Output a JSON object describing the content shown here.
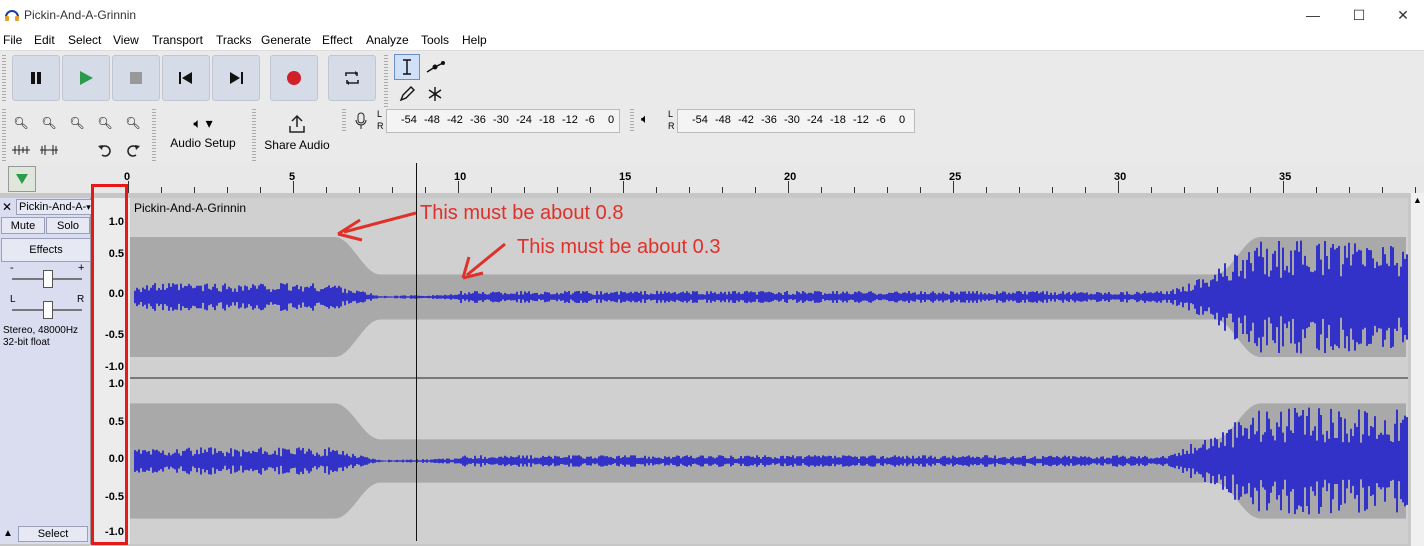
{
  "window": {
    "title": "Pickin-And-A-Grinnin",
    "minimize": "—",
    "maximize": "☐",
    "close": "✕"
  },
  "menu": [
    "File",
    "Edit",
    "Select",
    "View",
    "Transport",
    "Tracks",
    "Generate",
    "Effect",
    "Analyze",
    "Tools",
    "Help"
  ],
  "toolbar": {
    "audio_setup_label": "Audio Setup",
    "share_audio_label": "Share Audio",
    "record_meter_ticks": [
      "-54",
      "-48",
      "-42",
      "-36",
      "-30",
      "-24",
      "-18",
      "-12",
      "-6",
      "0"
    ],
    "playback_meter_ticks": [
      "-54",
      "-48",
      "-42",
      "-36",
      "-30",
      "-24",
      "-18",
      "-12",
      "-6",
      "0"
    ],
    "meter_lr": [
      "L",
      "R"
    ]
  },
  "timeline": {
    "ticks": [
      "0",
      "5",
      "10",
      "15",
      "20",
      "25",
      "30",
      "35"
    ]
  },
  "track": {
    "name": "Pickin-And-A-",
    "clip_name": "Pickin-And-A-Grinnin",
    "mute_label": "Mute",
    "solo_label": "Solo",
    "effects_label": "Effects",
    "gain_minus": "-",
    "gain_plus": "+",
    "pan_left": "L",
    "pan_right": "R",
    "format_line1": "Stereo, 48000Hz",
    "format_line2": "32-bit float",
    "select_label": "Select",
    "vruler_top": [
      "1.0",
      "0.5",
      "0.0",
      "-0.5",
      "-1.0"
    ],
    "vruler_bottom": [
      "1.0",
      "0.5",
      "0.0",
      "-0.5",
      "-1.0"
    ],
    "waveform_color": "#3232c8",
    "envelope_color": "#a9a9a9"
  },
  "annotations": {
    "arrow1_text": "This must be about 0.8",
    "arrow2_text": "This must be about 0.3",
    "color": "#e0302a"
  }
}
